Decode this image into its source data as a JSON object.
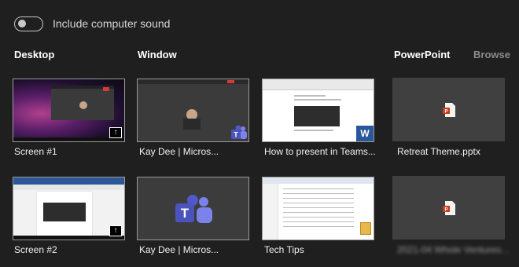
{
  "sound_toggle": {
    "label": "Include computer sound",
    "state": "off"
  },
  "sections": {
    "desktop": "Desktop",
    "window": "Window",
    "powerpoint": "PowerPoint",
    "browse": "Browse"
  },
  "desktop_items": [
    {
      "caption": "Screen #1"
    },
    {
      "caption": "Screen #2"
    }
  ],
  "window_items": [
    {
      "caption": "Kay Dee      | Micros..."
    },
    {
      "caption": "How to present in Teams..."
    },
    {
      "caption": "Kay Dee      | Micros..."
    },
    {
      "caption": "Tech Tips"
    }
  ],
  "powerpoint_items": [
    {
      "caption": "Retreat Theme.pptx"
    },
    {
      "caption": "2021-04 Whole Ventures.pptx"
    }
  ],
  "colors": {
    "background": "#1f1f1f",
    "tile": "#404040",
    "teams": "#5059c9",
    "ppt": "#c43e1c"
  }
}
